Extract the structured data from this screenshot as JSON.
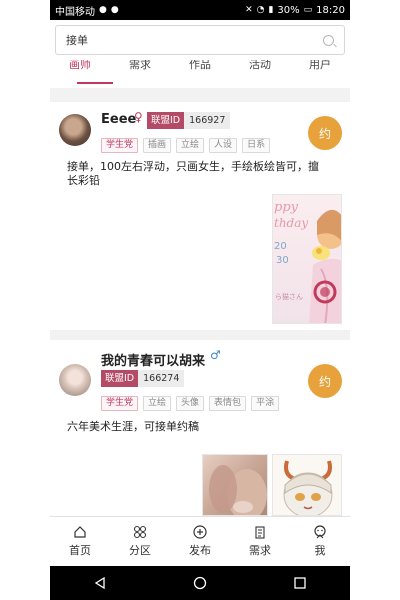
{
  "status": {
    "carrier": "中国移动",
    "battery": "30%",
    "time": "18:20"
  },
  "search": {
    "value": "接单"
  },
  "tabs": [
    "画师",
    "需求",
    "作品",
    "活动",
    "用户"
  ],
  "cards": [
    {
      "username": "Eeee",
      "gender_symbol": "♀",
      "gender_color": "#c13a5c",
      "id_label": "联盟ID",
      "id_value": "166927",
      "tags": [
        "学生党",
        "插画",
        "立绘",
        "人设",
        "日系"
      ],
      "action": "约",
      "desc_line1": "接单，100左右浮动，只画女生，手绘板绘皆可，擅",
      "desc_line2": "长彩铅",
      "art_text_1": "ppy",
      "art_text_2": "thday",
      "art_text_3": "20",
      "art_text_4": "30",
      "art_text_5": "ら猫さん"
    },
    {
      "username": "我的青春可以胡来",
      "gender_symbol": "♂",
      "gender_color": "#3a88c9",
      "id_label": "联盟ID",
      "id_value": "166274",
      "tags": [
        "学生党",
        "立绘",
        "头像",
        "表情包",
        "平涂"
      ],
      "action": "约",
      "desc": "六年美术生涯，可接单约稿"
    }
  ],
  "bottom_nav": [
    "首页",
    "分区",
    "发布",
    "需求",
    "我"
  ]
}
